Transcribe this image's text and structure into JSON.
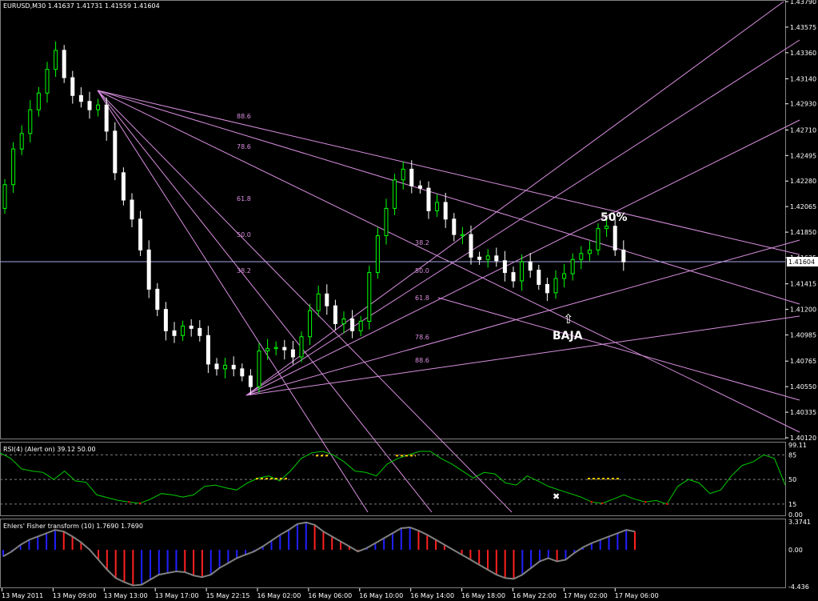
{
  "main": {
    "header": "EURUSD,M30  1.41637 1.41731 1.41559 1.41604",
    "price_tag": "1.41604",
    "current_price": 1.41604,
    "price_ticks": [
      "1.43790",
      "1.43575",
      "1.43360",
      "1.43140",
      "1.42930",
      "1.42710",
      "1.42495",
      "1.42280",
      "1.42065",
      "1.41850",
      "1.41635",
      "1.41415",
      "1.41200",
      "1.40985",
      "1.40765",
      "1.40550",
      "1.40335",
      "1.40120"
    ],
    "fan_a_labels": [
      "88.6",
      "78.6",
      "61.8",
      "50.0",
      "38.2"
    ],
    "fan_b_labels": [
      "38.2",
      "50.0",
      "61.8",
      "78.6",
      "88.6"
    ],
    "annotation_50": "50%",
    "annotation_baja": "BAJA",
    "arrow_glyph": "⇧",
    "colors": {
      "bull": "#00ff00",
      "bear": "#ffffff",
      "fib": "#d98fe0",
      "price_line": "#a9a9e8",
      "grid": "#606060"
    }
  },
  "rsi": {
    "label": "RSI(4) (Alert on) 39.12 50.00",
    "ticks": [
      "99.11",
      "85",
      "50",
      "15",
      "0.00"
    ],
    "current": 39.12,
    "levels": [
      85,
      50,
      15
    ],
    "cross_glyph": "✖",
    "colors": {
      "line": "#00cc00",
      "low": "#ff0000",
      "alert": "#ffd000"
    }
  },
  "fisher": {
    "label": "Ehlers' Fisher transform (10) 1.7690 1.7690",
    "ticks": [
      "3.3741",
      "0.00",
      "-4.436"
    ],
    "current": 1.769,
    "colors": {
      "up": "#2020ff",
      "down": "#ff2020",
      "line": "#808080"
    }
  },
  "time_axis": [
    "13 May 2011",
    "13 May 09:00",
    "13 May 13:00",
    "13 May 17:00",
    "15 May 22:15",
    "16 May 02:00",
    "16 May 06:00",
    "16 May 10:00",
    "16 May 14:00",
    "16 May 18:00",
    "16 May 22:00",
    "17 May 02:00",
    "17 May 06:00"
  ],
  "chart_data": {
    "type": "candlestick",
    "title": "EURUSD,M30",
    "ohlc_header": {
      "open": 1.41637,
      "high": 1.41731,
      "low": 1.41559,
      "close": 1.41604
    },
    "ylim": [
      1.4012,
      1.4379
    ],
    "closes": [
      1.4225,
      1.4255,
      1.4268,
      1.4288,
      1.4302,
      1.4322,
      1.4338,
      1.4315,
      1.43,
      1.4295,
      1.4288,
      1.4292,
      1.427,
      1.4235,
      1.4212,
      1.4196,
      1.417,
      1.4137,
      1.412,
      1.4102,
      1.4098,
      1.4106,
      1.4104,
      1.4098,
      1.4074,
      1.407,
      1.4073,
      1.407,
      1.4064,
      1.4055,
      1.4085,
      1.4087,
      1.4088,
      1.4086,
      1.408,
      1.4097,
      1.4119,
      1.4133,
      1.4123,
      1.4108,
      1.4112,
      1.4102,
      1.411,
      1.4151,
      1.4182,
      1.4205,
      1.4229,
      1.4238,
      1.4224,
      1.4222,
      1.4203,
      1.421,
      1.4196,
      1.4183,
      1.4183,
      1.4164,
      1.4162,
      1.4165,
      1.4161,
      1.4151,
      1.4144,
      1.416,
      1.4153,
      1.4141,
      1.4134,
      1.4146,
      1.415,
      1.4162,
      1.4167,
      1.417,
      1.4188,
      1.419,
      1.417,
      1.416
    ]
  }
}
